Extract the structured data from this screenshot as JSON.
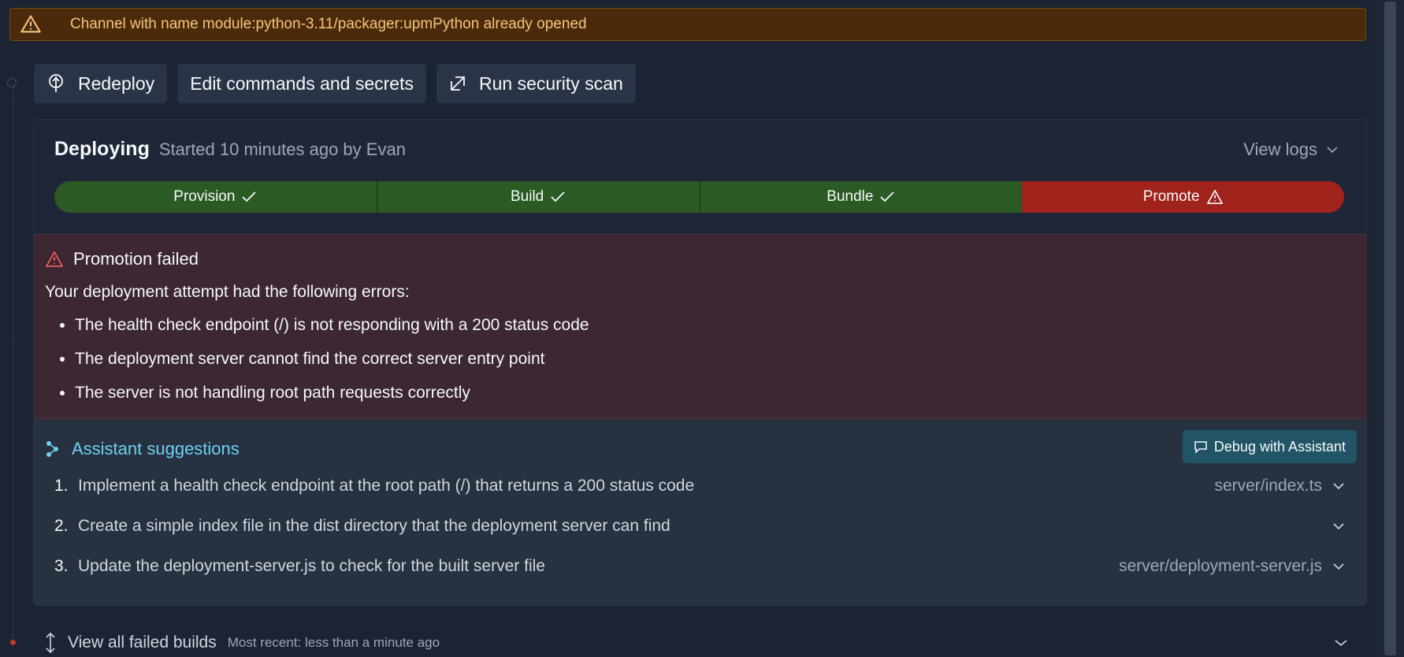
{
  "banner": {
    "message": "Channel with name module:python-3.11/packager:upmPython already opened",
    "icon": "warning-icon",
    "color": "#4b2a0c"
  },
  "actions": [
    {
      "label": "Redeploy",
      "icon": "redeploy-icon"
    },
    {
      "label": "Edit commands and secrets"
    },
    {
      "label": "Run security scan",
      "icon": "external-scan-icon"
    }
  ],
  "deployment": {
    "status": "Deploying",
    "meta": "Started 10 minutes ago by Evan",
    "view_logs": "View logs",
    "stages": [
      {
        "label": "Provision",
        "state": "success"
      },
      {
        "label": "Build",
        "state": "success"
      },
      {
        "label": "Bundle",
        "state": "success"
      },
      {
        "label": "Promote",
        "state": "failed"
      }
    ]
  },
  "error": {
    "title": "Promotion failed",
    "intro": "Your deployment attempt had the following errors:",
    "items": [
      "The health check endpoint (/) is not responding with a 200 status code",
      "The deployment server cannot find the correct server entry point",
      "The server is not handling root path requests correctly"
    ]
  },
  "assistant": {
    "title": "Assistant suggestions",
    "debug_button": "Debug with Assistant",
    "suggestions": [
      {
        "num": "1.",
        "text": "Implement a health check endpoint at the root path (/) that returns a 200 status code",
        "file": "server/index.ts"
      },
      {
        "num": "2.",
        "text": "Create a simple index file in the dist directory that the deployment server can find",
        "file": ""
      },
      {
        "num": "3.",
        "text": "Update the deployment-server.js to check for the built server file",
        "file": "server/deployment-server.js"
      }
    ]
  },
  "failed_builds": {
    "label": "View all failed builds",
    "recent": "Most recent: less than a minute ago"
  },
  "colors": {
    "success": "#2c5a24",
    "failed": "#a0231c",
    "accent": "#6ad2f5"
  }
}
